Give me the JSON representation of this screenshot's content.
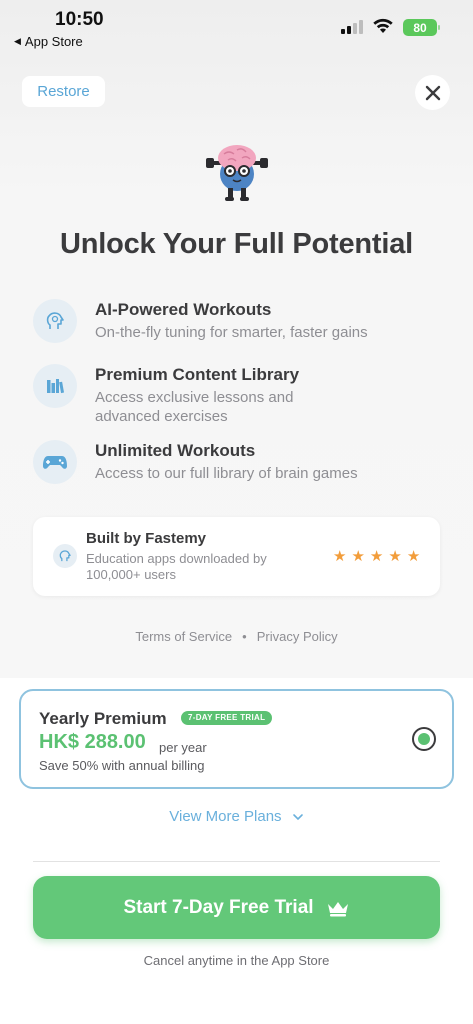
{
  "status_bar": {
    "time": "10:50",
    "back_label": "App Store",
    "battery": "80"
  },
  "header": {
    "restore_label": "Restore"
  },
  "headline": "Unlock Your Full Potential",
  "features": [
    {
      "icon": "head-icon",
      "title": "AI-Powered Workouts",
      "desc": "On-the-fly tuning for smarter, faster gains"
    },
    {
      "icon": "library-icon",
      "title": "Premium Content Library",
      "desc": "Access exclusive lessons and advanced exercises"
    },
    {
      "icon": "gamepad-icon",
      "title": "Unlimited Workouts",
      "desc": "Access to our full library of brain games"
    }
  ],
  "built_by": {
    "title": "Built by Fastemy",
    "desc": "Education apps downloaded by 100,000+ users",
    "rating_stars": 5
  },
  "legal": {
    "terms": "Terms of Service",
    "separator": "•",
    "privacy": "Privacy Policy"
  },
  "plan": {
    "title": "Yearly Premium",
    "badge": "7-DAY FREE TRIAL",
    "price": "HK$ 288.00",
    "period": "per year",
    "save": "Save 50% with annual billing",
    "selected": true
  },
  "more_plans_label": "View More Plans",
  "cta_label": "Start 7-Day Free Trial",
  "cancel_note": "Cancel anytime in the App Store",
  "colors": {
    "accent_green": "#5bc172",
    "accent_blue": "#5aa6d6",
    "star": "#f29d3b"
  }
}
